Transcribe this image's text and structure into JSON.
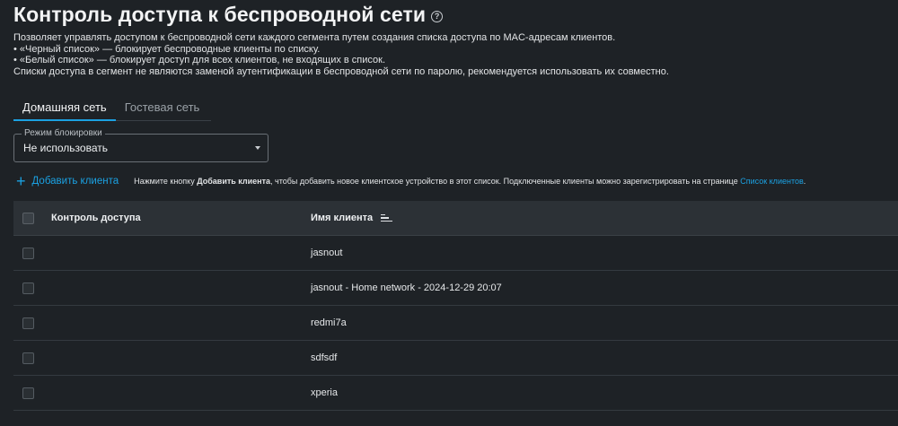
{
  "header": {
    "title": "Контроль доступа к беспроводной сети",
    "help_icon": "?"
  },
  "description": {
    "lines": [
      "Позволяет управлять доступом к беспроводной сети каждого сегмента путем создания списка доступа по MAC-адресам клиентов.",
      "• «Черный список» — блокирует беспроводные клиенты по списку.",
      "• «Белый список» — блокирует доступ для всех клиентов, не входящих в список.",
      "Списки доступа в сегмент не являются заменой аутентификации в беспроводной сети по паролю, рекомендуется использовать их совместно."
    ]
  },
  "tabs": [
    {
      "label": "Домашняя сеть",
      "active": true
    },
    {
      "label": "Гостевая сеть",
      "active": false
    }
  ],
  "block_mode": {
    "label": "Режим блокировки",
    "value": "Не использовать"
  },
  "toolbar": {
    "add_label": "Добавить клиента",
    "hint_pre": "Нажмите кнопку ",
    "hint_bold": "Добавить клиента",
    "hint_mid": ", чтобы добавить новое клиентское устройство в этот список. Подключенные клиенты можно зарегистрировать на странице ",
    "hint_link": "Список клиентов",
    "hint_end": "."
  },
  "table": {
    "columns": {
      "access": "Контроль доступа",
      "name": "Имя клиента"
    },
    "rows": [
      {
        "access": "",
        "name": "jasnout"
      },
      {
        "access": "",
        "name": "jasnout - Home network - 2024-12-29 20:07"
      },
      {
        "access": "",
        "name": "redmi7a"
      },
      {
        "access": "",
        "name": "sdfsdf"
      },
      {
        "access": "",
        "name": "xperia"
      }
    ]
  },
  "colors": {
    "accent": "#1ba1e2",
    "background": "#1e2226",
    "header_bg": "#2c3136"
  }
}
